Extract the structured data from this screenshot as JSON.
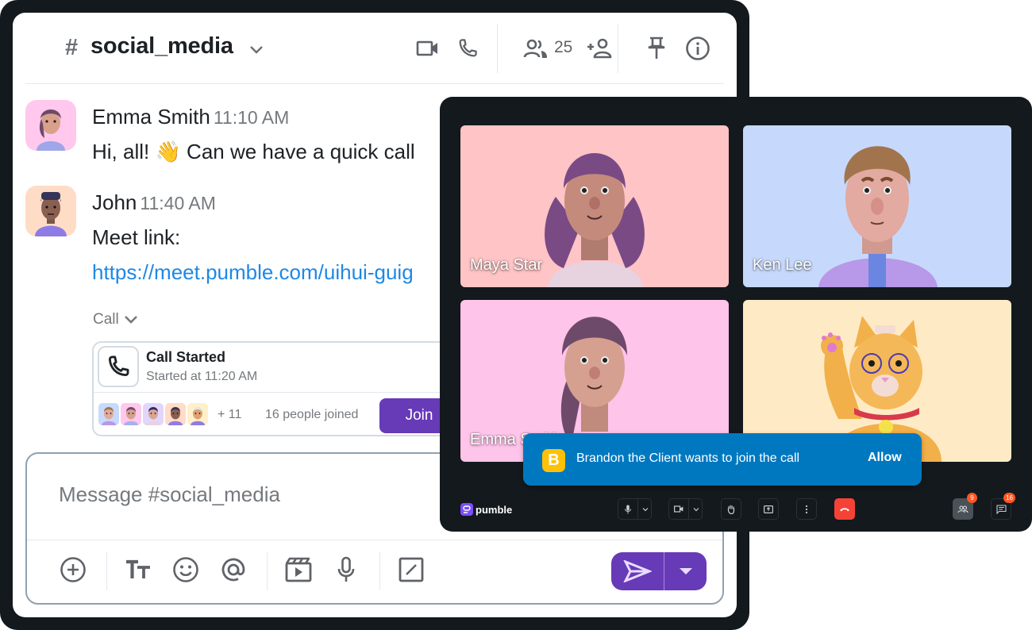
{
  "chat": {
    "channel": {
      "hash": "#",
      "name": "social_media"
    },
    "header_icons": [
      "video-call-icon",
      "phone-call-icon",
      "members-icon",
      "add-member-icon",
      "pin-icon",
      "info-icon"
    ],
    "member_count": "25",
    "messages": [
      {
        "author": "Emma Smith",
        "time": "11:10 AM",
        "text": "Hi, all! 👋  Can we have a quick call",
        "avatar_bg": "#ffc8ec"
      },
      {
        "author": "John",
        "time": "11:40 AM",
        "text": "Meet link:",
        "link": "https://meet.pumble.com/uihui-guig",
        "avatar_bg": "#ffdcc6"
      }
    ],
    "call_toggle_label": "Call",
    "call_card": {
      "title": "Call Started",
      "subtitle": "Started at 11:20 AM",
      "extra_count": "+ 11",
      "joined_text": "16 people joined",
      "join_label": "Join",
      "participant_avatar_bgs": [
        "#c7dafc",
        "#ffc8ec",
        "#e2d6fb",
        "#ffdcc6",
        "#fff0c8"
      ]
    },
    "composer": {
      "placeholder": "Message #social_media",
      "tools": [
        "add-icon",
        "text-format-icon",
        "emoji-icon",
        "mention-icon",
        "media-icon",
        "microphone-icon",
        "slash-command-icon"
      ]
    },
    "colors": {
      "accent": "#673ab7",
      "link": "#1e88e5",
      "frame": "#13191d"
    }
  },
  "meeting": {
    "tiles": [
      {
        "name": "Maya Star",
        "bg": "#ffc4c6"
      },
      {
        "name": "Ken Lee",
        "bg": "#c6d9fc"
      },
      {
        "name": "Emma Smith",
        "bg": "#ffc4ea"
      },
      {
        "name": "",
        "bg": "#ffeac6"
      }
    ],
    "toast": {
      "badge": "B",
      "text": "Brandon the Client wants to join the call",
      "action": "Allow",
      "color": "#0078c0"
    },
    "brand": "pumble",
    "controls": {
      "participants_badge": "9",
      "chat_badge": "16"
    }
  }
}
